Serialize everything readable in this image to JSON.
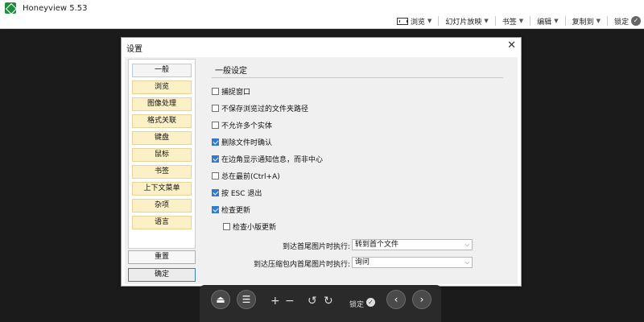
{
  "app": {
    "title": "Honeyview 5.53"
  },
  "toolbar": {
    "browse": "浏览",
    "slideshow": "幻灯片放映",
    "bookmark": "书签",
    "edit": "编辑",
    "copy_to": "复制到",
    "lock": "锁定"
  },
  "dialog": {
    "title": "设置",
    "nav": [
      "一般",
      "浏览",
      "图像处理",
      "格式关联",
      "键盘",
      "鼠标",
      "书签",
      "上下文菜单",
      "杂项",
      "语言"
    ],
    "active_nav": "一般",
    "reset": "重置",
    "ok": "确定",
    "section_title": "一般设定",
    "options": [
      {
        "label": "捕捉窗口",
        "checked": false
      },
      {
        "label": "不保存浏览过的文件夹路径",
        "checked": false
      },
      {
        "label": "不允许多个实体",
        "checked": false
      },
      {
        "label": "删除文件时确认",
        "checked": true
      },
      {
        "label": "在边角显示通知信息，而非中心",
        "checked": true
      },
      {
        "label": "总在最前(Ctrl+A)",
        "checked": false
      },
      {
        "label": "按 ESC 退出",
        "checked": true
      },
      {
        "label": "检查更新",
        "checked": true
      },
      {
        "label": "检查小版更新",
        "checked": false
      }
    ],
    "selects": [
      {
        "label": "到达首尾图片时执行:",
        "value": "转到首个文件"
      },
      {
        "label": "到达压缩包内首尾图片时执行:",
        "value": "询问"
      }
    ]
  },
  "controls": {
    "zoom_in": "+",
    "zoom_out": "−",
    "lock_label": "锁定"
  }
}
